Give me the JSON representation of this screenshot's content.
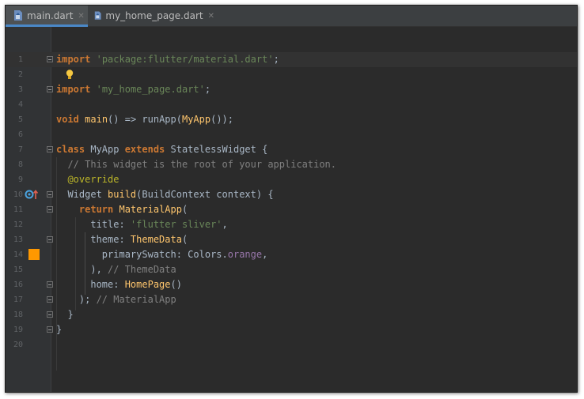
{
  "tabs": [
    {
      "label": "main.dart",
      "active": true
    },
    {
      "label": "my_home_page.dart",
      "active": false
    }
  ],
  "colors": {
    "swatch_orange": "#ff9800",
    "accent_tab": "#4a88c7"
  },
  "editor": {
    "lines": [
      {
        "n": "1",
        "html": "<span class=\"kw\">import</span> <span class=\"str\">'package:flutter/material.dart'</span>;"
      },
      {
        "n": "2",
        "html": ""
      },
      {
        "n": "3",
        "html": "<span class=\"kw\">import</span> <span class=\"str\">'my_home_page.dart'</span>;"
      },
      {
        "n": "4",
        "html": ""
      },
      {
        "n": "5",
        "html": "<span class=\"kw\">void</span> <span class=\"fn\">main</span>() =&gt; runApp(<span class=\"fn\">MyApp</span>());"
      },
      {
        "n": "6",
        "html": ""
      },
      {
        "n": "7",
        "html": "<span class=\"kw\">class</span> MyApp <span class=\"kw\">extends</span> StatelessWidget {"
      },
      {
        "n": "8",
        "html": "  <span class=\"cm\">// This widget is the root of your application.</span>"
      },
      {
        "n": "9",
        "html": "  <span class=\"an\">@override</span>"
      },
      {
        "n": "10",
        "html": "  Widget <span class=\"fn\">build</span>(BuildContext context) {"
      },
      {
        "n": "11",
        "html": "    <span class=\"kw\">return</span> <span class=\"fn\">MaterialApp</span>("
      },
      {
        "n": "12",
        "html": "      title: <span class=\"str\">'flutter sliver'</span>,"
      },
      {
        "n": "13",
        "html": "      theme: <span class=\"fn\">ThemeData</span>("
      },
      {
        "n": "14",
        "html": "        primarySwatch: Colors.<span class=\"pr\">orange</span>,"
      },
      {
        "n": "15",
        "html": "      ), <span class=\"cm\">// ThemeData</span>"
      },
      {
        "n": "16",
        "html": "      home: <span class=\"fn\">HomePage</span>()"
      },
      {
        "n": "17",
        "html": "    ); <span class=\"cm\">// MaterialApp</span>"
      },
      {
        "n": "18",
        "html": "  }"
      },
      {
        "n": "19",
        "html": "}"
      },
      {
        "n": "20",
        "html": ""
      }
    ]
  }
}
